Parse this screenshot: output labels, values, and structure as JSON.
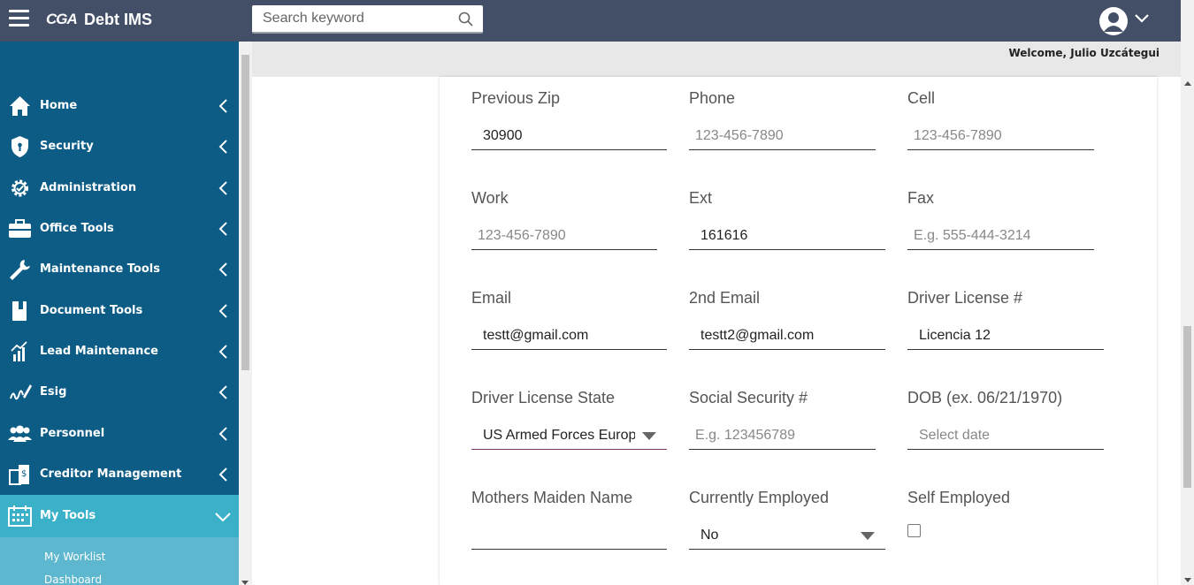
{
  "header": {
    "logo_text": "CGA",
    "app_title": "Debt IMS",
    "search_placeholder": "Search keyword",
    "welcome": "Welcome, Julio Uzcátegui"
  },
  "sidebar": {
    "items": [
      {
        "label": "Home",
        "icon": "home-icon"
      },
      {
        "label": "Security",
        "icon": "shield-icon"
      },
      {
        "label": "Administration",
        "icon": "gear-icon"
      },
      {
        "label": "Office Tools",
        "icon": "briefcase-icon"
      },
      {
        "label": "Maintenance Tools",
        "icon": "wrench-icon"
      },
      {
        "label": "Document Tools",
        "icon": "book-icon"
      },
      {
        "label": "Lead Maintenance",
        "icon": "chart-icon"
      },
      {
        "label": "Esig",
        "icon": "signature-icon"
      },
      {
        "label": "Personnel",
        "icon": "people-icon"
      },
      {
        "label": "Creditor Management",
        "icon": "building-icon"
      },
      {
        "label": "My Tools",
        "icon": "calendar-icon"
      }
    ],
    "subitems": [
      {
        "label": "My Worklist"
      },
      {
        "label": "Dashboard"
      }
    ]
  },
  "form": {
    "previous_zip": {
      "label": "Previous Zip",
      "value": "30900"
    },
    "phone": {
      "label": "Phone",
      "placeholder": "123-456-7890"
    },
    "cell": {
      "label": "Cell",
      "placeholder": "123-456-7890"
    },
    "work": {
      "label": "Work",
      "placeholder": "123-456-7890"
    },
    "ext": {
      "label": "Ext",
      "value": "161616"
    },
    "fax": {
      "label": "Fax",
      "placeholder": "E.g. 555-444-3214"
    },
    "email": {
      "label": "Email",
      "value": "testt@gmail.com"
    },
    "email2": {
      "label": "2nd Email",
      "value": "testt2@gmail.com"
    },
    "driver_license": {
      "label": "Driver License #",
      "value": "Licencia 12"
    },
    "driver_license_state": {
      "label": "Driver License State",
      "value": "US Armed Forces Europe"
    },
    "ssn": {
      "label": "Social Security #",
      "placeholder": "E.g. 123456789"
    },
    "dob": {
      "label": "DOB (ex. 06/21/1970)",
      "placeholder": "Select date"
    },
    "mothers_maiden": {
      "label": "Mothers Maiden Name",
      "value": ""
    },
    "currently_employed": {
      "label": "Currently Employed",
      "value": "No"
    },
    "self_employed": {
      "label": "Self Employed",
      "checked": false
    }
  },
  "colors": {
    "topbar": "#434f66",
    "sidebar": "#0d5c86",
    "sidebar_active": "#3bb1c9",
    "submenu": "#5db7cf"
  }
}
